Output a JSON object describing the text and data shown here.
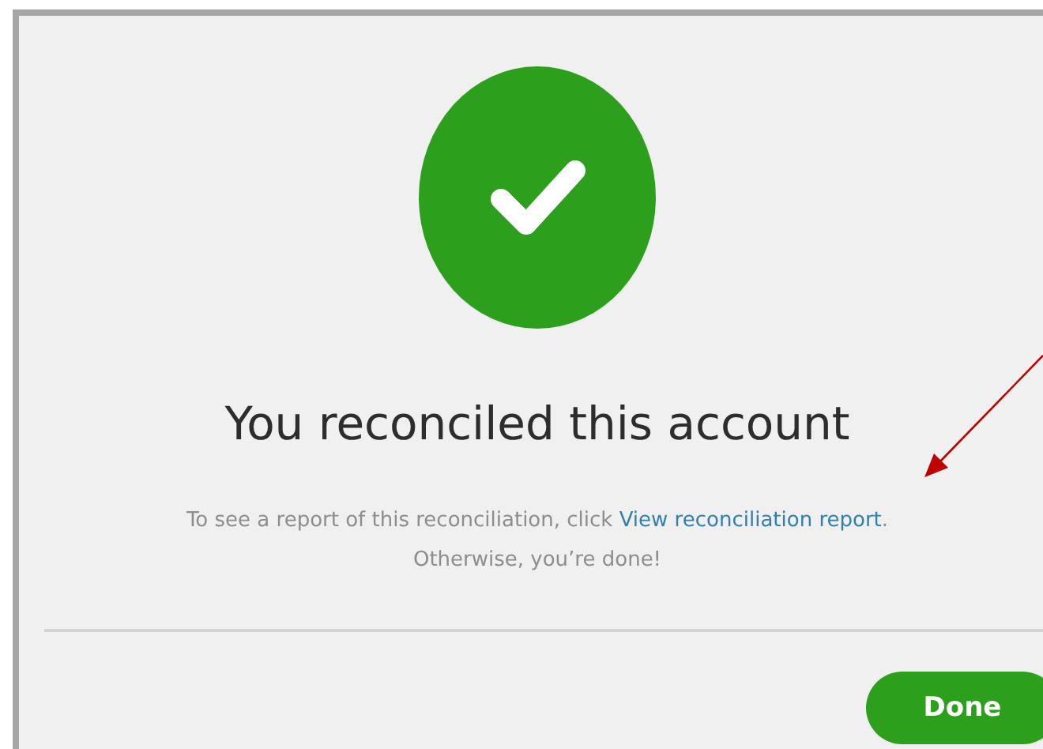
{
  "dialog": {
    "title": "You reconciled this account",
    "message": {
      "lead": "To see a report of this reconciliation, click ",
      "link": "View reconciliation report",
      "trail": "."
    },
    "message_2": "Otherwise, you’re done!",
    "buttons": [
      {
        "kind": "primary",
        "label": "Done"
      }
    ]
  }
}
